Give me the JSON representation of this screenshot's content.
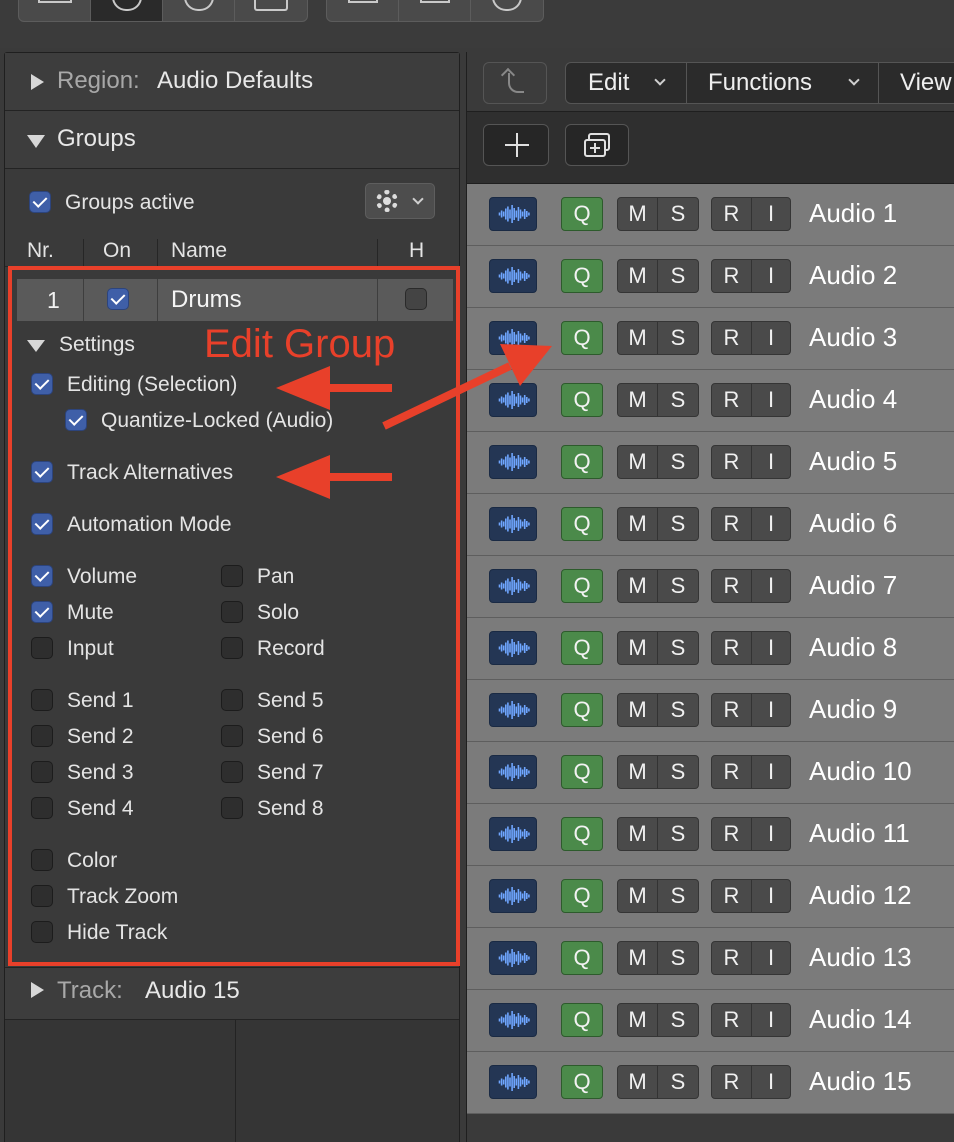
{
  "inspector": {
    "region": {
      "label": "Region:",
      "value": "Audio Defaults"
    },
    "groups": {
      "title": "Groups",
      "active_label": "Groups active",
      "active_checked": true,
      "columns": {
        "nr": "Nr.",
        "on": "On",
        "name": "Name",
        "h": "H"
      },
      "rows": [
        {
          "nr": "1",
          "on": true,
          "name": "Drums",
          "h": false
        }
      ],
      "settings": {
        "title": "Settings",
        "editing_selection": {
          "label": "Editing (Selection)",
          "checked": true
        },
        "quantize_locked": {
          "label": "Quantize-Locked (Audio)",
          "checked": true
        },
        "track_alternatives": {
          "label": "Track Alternatives",
          "checked": true
        },
        "automation_mode": {
          "label": "Automation Mode",
          "checked": true
        },
        "volume": {
          "label": "Volume",
          "checked": true
        },
        "pan": {
          "label": "Pan",
          "checked": false
        },
        "mute": {
          "label": "Mute",
          "checked": true
        },
        "solo": {
          "label": "Solo",
          "checked": false
        },
        "input": {
          "label": "Input",
          "checked": false
        },
        "record": {
          "label": "Record",
          "checked": false
        },
        "send1": {
          "label": "Send 1",
          "checked": false
        },
        "send2": {
          "label": "Send 2",
          "checked": false
        },
        "send3": {
          "label": "Send 3",
          "checked": false
        },
        "send4": {
          "label": "Send 4",
          "checked": false
        },
        "send5": {
          "label": "Send 5",
          "checked": false
        },
        "send6": {
          "label": "Send 6",
          "checked": false
        },
        "send7": {
          "label": "Send 7",
          "checked": false
        },
        "send8": {
          "label": "Send 8",
          "checked": false
        },
        "color": {
          "label": "Color",
          "checked": false
        },
        "track_zoom": {
          "label": "Track Zoom",
          "checked": false
        },
        "hide_track": {
          "label": "Hide Track",
          "checked": false
        }
      }
    },
    "track": {
      "label": "Track:",
      "value": "Audio 15"
    }
  },
  "annotation": {
    "text": "Edit Group",
    "color": "#e8402a"
  },
  "menu": {
    "edit": "Edit",
    "functions": "Functions",
    "view": "View"
  },
  "track_buttons": {
    "q": "Q",
    "m": "M",
    "s": "S",
    "r": "R",
    "i": "I"
  },
  "tracks": [
    {
      "name": "Audio 1",
      "record_armed": false
    },
    {
      "name": "Audio 2",
      "record_armed": false
    },
    {
      "name": "Audio 3",
      "record_armed": false
    },
    {
      "name": "Audio 4",
      "record_armed": false
    },
    {
      "name": "Audio 5",
      "record_armed": false
    },
    {
      "name": "Audio 6",
      "record_armed": false
    },
    {
      "name": "Audio 7",
      "record_armed": false
    },
    {
      "name": "Audio 8",
      "record_armed": false
    },
    {
      "name": "Audio 9",
      "record_armed": false
    },
    {
      "name": "Audio 10",
      "record_armed": false
    },
    {
      "name": "Audio 11",
      "record_armed": false
    },
    {
      "name": "Audio 12",
      "record_armed": false
    },
    {
      "name": "Audio 13",
      "record_armed": false
    },
    {
      "name": "Audio 14",
      "record_armed": false
    },
    {
      "name": "Audio 15",
      "record_armed": true
    }
  ],
  "colors": {
    "quantize_green": "#4b8a4a",
    "record_red": "#e8402a",
    "checkbox_blue": "#3f5fa8",
    "track_row": "#7b7b7b"
  }
}
